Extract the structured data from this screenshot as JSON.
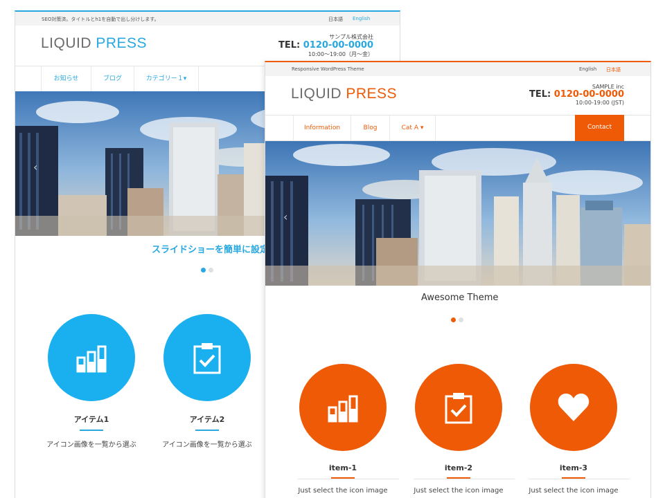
{
  "colors": {
    "blue_accent": "#29a8e0",
    "orange_accent": "#ee5a06",
    "text_dark": "#333333",
    "logo_gray": "#6b6b6b"
  },
  "site_blue": {
    "tagline": "SEO対策済。タイトルとh1を自動で出し分けします。",
    "lang_japanese": "日本語",
    "lang_english": "English",
    "logo_part1": "LIQUID",
    "logo_part2": "PRESS",
    "company": "サンプル株式会社",
    "tel_label": "TEL:",
    "tel_number": "0120-00-0000",
    "hours": "10:00〜19:00（月〜金）",
    "nav": [
      "お知らせ",
      "ブログ",
      "カテゴリー１▾"
    ],
    "slide_caption": "スライドショーを簡単に設定",
    "features": [
      {
        "icon": "bar-chart-icon",
        "title": "アイテム1",
        "desc": "アイコン画像を一覧から選ぶ"
      },
      {
        "icon": "clipboard-check-icon",
        "title": "アイテム2",
        "desc": "アイコン画像を一覧から選ぶ"
      }
    ]
  },
  "site_orange": {
    "tagline": "Responsive WordPress Theme",
    "lang_english": "English",
    "lang_japanese": "日本語",
    "logo_part1": "LIQUID",
    "logo_part2": "PRESS",
    "company": "SAMPLE inc",
    "tel_label": "TEL:",
    "tel_number": "0120-00-0000",
    "hours": "10:00-19:00 (JST)",
    "nav": [
      "Information",
      "Blog",
      "Cat A ▾"
    ],
    "contact_button": "Contact",
    "slide_caption": "Awesome Theme",
    "features": [
      {
        "icon": "bar-chart-icon",
        "title": "item-1",
        "desc": "Just select the icon image"
      },
      {
        "icon": "clipboard-check-icon",
        "title": "item-2",
        "desc": "Just select the icon image"
      },
      {
        "icon": "heart-icon",
        "title": "item-3",
        "desc": "Just select the icon image"
      }
    ]
  }
}
